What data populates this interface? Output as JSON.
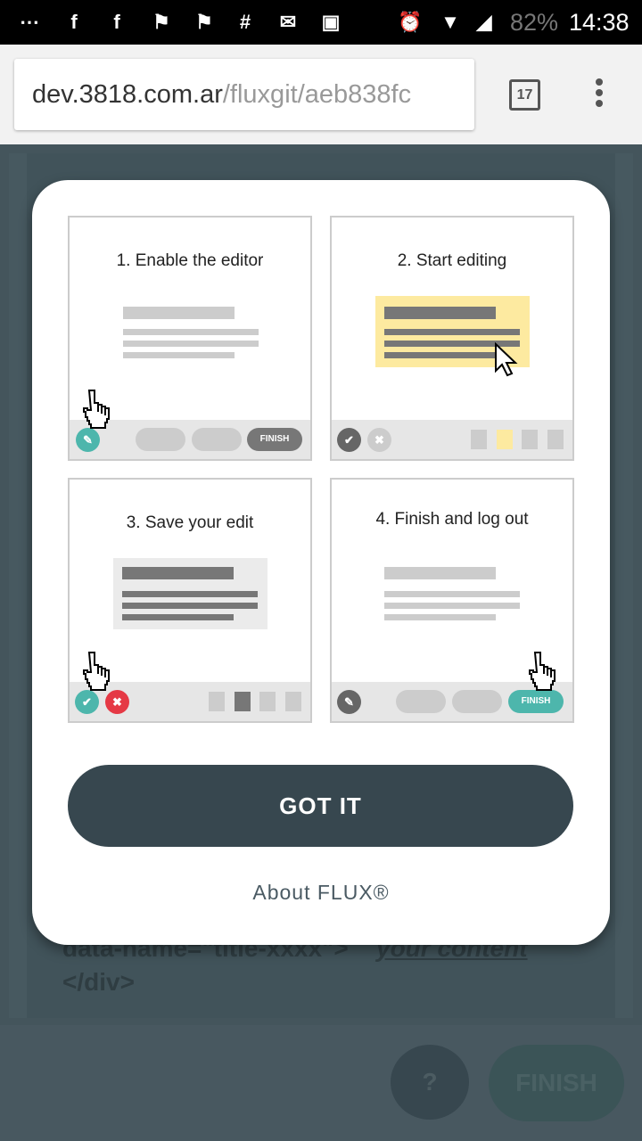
{
  "status_bar": {
    "icons": [
      "more-notifications-icon",
      "facebook-icon",
      "facebook-icon",
      "flag-icon",
      "flag-icon",
      "slack-icon",
      "inbox-icon",
      "image-icon",
      "alarm-icon",
      "wifi-icon",
      "signal-icon"
    ],
    "battery": "82%",
    "time": "14:38"
  },
  "browser": {
    "url_host": "dev.3818.com.ar",
    "url_path": "/fluxgit/aeb838fc",
    "tab_count": "17"
  },
  "background_page": {
    "code_line_1": "data-name=\"title-xxxx\">",
    "code_link": "your content",
    "code_line_2": "</div>",
    "help_label": "?",
    "finish_label": "FINISH"
  },
  "modal": {
    "steps": [
      {
        "title": "1. Enable the editor",
        "finish_label": "FINISH"
      },
      {
        "title": "2. Start editing"
      },
      {
        "title": "3. Save your edit"
      },
      {
        "title": "4. Finish and log out",
        "finish_label": "FINISH"
      }
    ],
    "got_it_label": "GOT IT",
    "about_label": "About FLUX®"
  },
  "colors": {
    "teal": "#4db6ac",
    "dark": "#37474f",
    "red": "#e53945",
    "highlight": "#fdeaa0"
  }
}
